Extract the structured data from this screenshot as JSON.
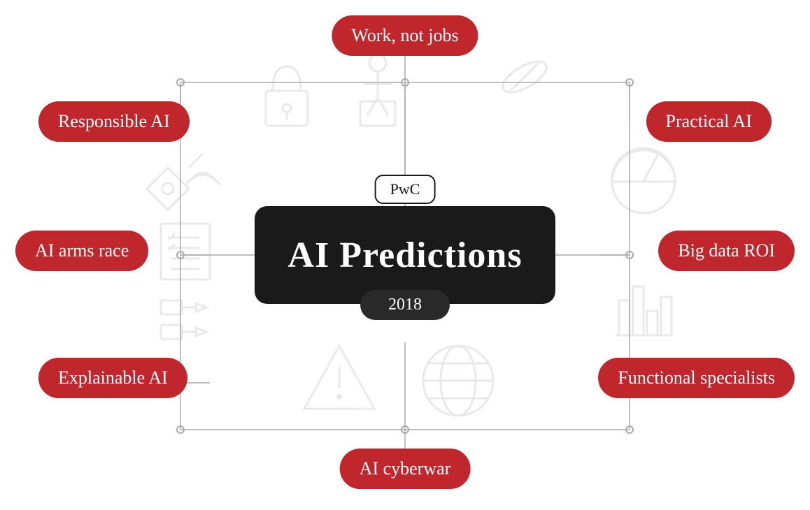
{
  "title": "AI Predictions 2018",
  "pwc_label": "PwC",
  "year_label": "2018",
  "main_title": "AI Predictions",
  "labels": {
    "work_not_jobs": "Work, not jobs",
    "responsible_ai": "Responsible AI",
    "practical_ai": "Practical AI",
    "ai_arms_race": "AI arms race",
    "big_data_roi": "Big data ROI",
    "explainable_ai": "Explainable AI",
    "functional_specialists": "Functional specialists",
    "ai_cyberwar": "AI cyberwar"
  },
  "colors": {
    "red": "#c0272d",
    "dark": "#1a1a1a",
    "white": "#ffffff",
    "line_gray": "#cccccc"
  }
}
